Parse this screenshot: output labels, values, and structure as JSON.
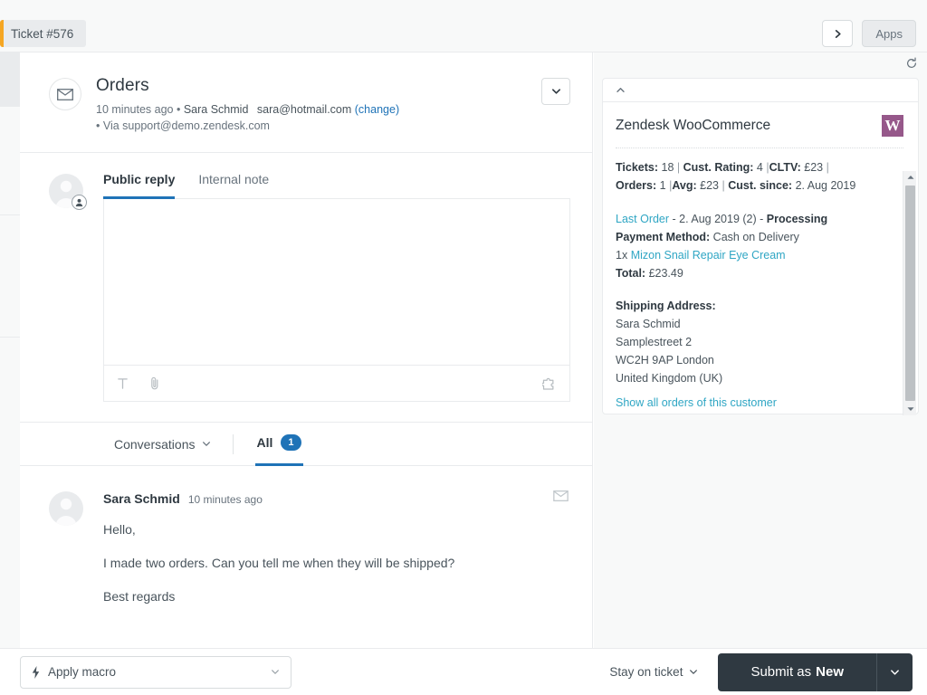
{
  "topbar": {
    "ticket_tab_label": "Ticket #576",
    "accent_color": "#f5a623",
    "apps_label": "Apps",
    "next_icon": "chevron-right-icon"
  },
  "ticket": {
    "subject": "Orders",
    "channel_icon": "envelope-icon",
    "meta_time": "10 minutes ago",
    "meta_sep": "•",
    "requester_name": "Sara Schmid",
    "requester_email": "sara@hotmail.com",
    "change_link": "(change)",
    "via_line": "• Via support@demo.zendesk.com"
  },
  "composer": {
    "tabs": [
      {
        "label": "Public reply",
        "active": true
      },
      {
        "label": "Internal note",
        "active": false
      }
    ],
    "body_value": "",
    "toolbar": {
      "text_format_icon": "text-format-icon",
      "attachment_icon": "paperclip-icon",
      "apps_icon": "puzzle-piece-icon"
    }
  },
  "conversations": {
    "dropdown_label": "Conversations",
    "all_label": "All",
    "all_count": "1"
  },
  "messages": [
    {
      "author": "Sara Schmid",
      "time": "10 minutes ago",
      "channel_icon": "envelope-icon",
      "paragraphs": [
        "Hello,",
        "I made two orders. Can you tell me when they will be shipped?",
        "Best regards"
      ]
    }
  ],
  "app_panel": {
    "refresh_icon": "refresh-icon",
    "collapse_icon": "chevron-up-icon",
    "title": "Zendesk WooCommerce",
    "logo_letter": "W",
    "logo_color": "#96588a",
    "link_color": "#2fa6c4",
    "stats": {
      "tickets_label": "Tickets:",
      "tickets_value": "18",
      "rating_label": "Cust. Rating:",
      "rating_value": "4",
      "cltv_label": "CLTV:",
      "cltv_value": "£23",
      "orders_label": "Orders:",
      "orders_value": "1",
      "avg_label": "Avg:",
      "avg_value": "£23",
      "since_label": "Cust. since:",
      "since_value": "2. Aug 2019"
    },
    "order": {
      "last_order_link": "Last Order",
      "order_date": "- 2. Aug 2019 (2) -",
      "status": "Processing",
      "payment_label": "Payment Method:",
      "payment_value": "Cash on Delivery",
      "item_qty": "1x",
      "item_name": "Mizon Snail Repair Eye Cream",
      "total_label": "Total:",
      "total_value": "£23.49"
    },
    "shipping": {
      "title": "Shipping Address:",
      "lines": [
        "Sara Schmid",
        "Samplestreet 2",
        "WC2H 9AP London",
        "United Kingdom (UK)"
      ]
    },
    "show_all_link": "Show all orders of this customer"
  },
  "bottom": {
    "macro_icon": "lightning-bolt-icon",
    "macro_label": "Apply macro",
    "stay_label": "Stay on ticket",
    "submit_prefix": "Submit as",
    "submit_status": "New",
    "submit_color": "#2f3941"
  }
}
